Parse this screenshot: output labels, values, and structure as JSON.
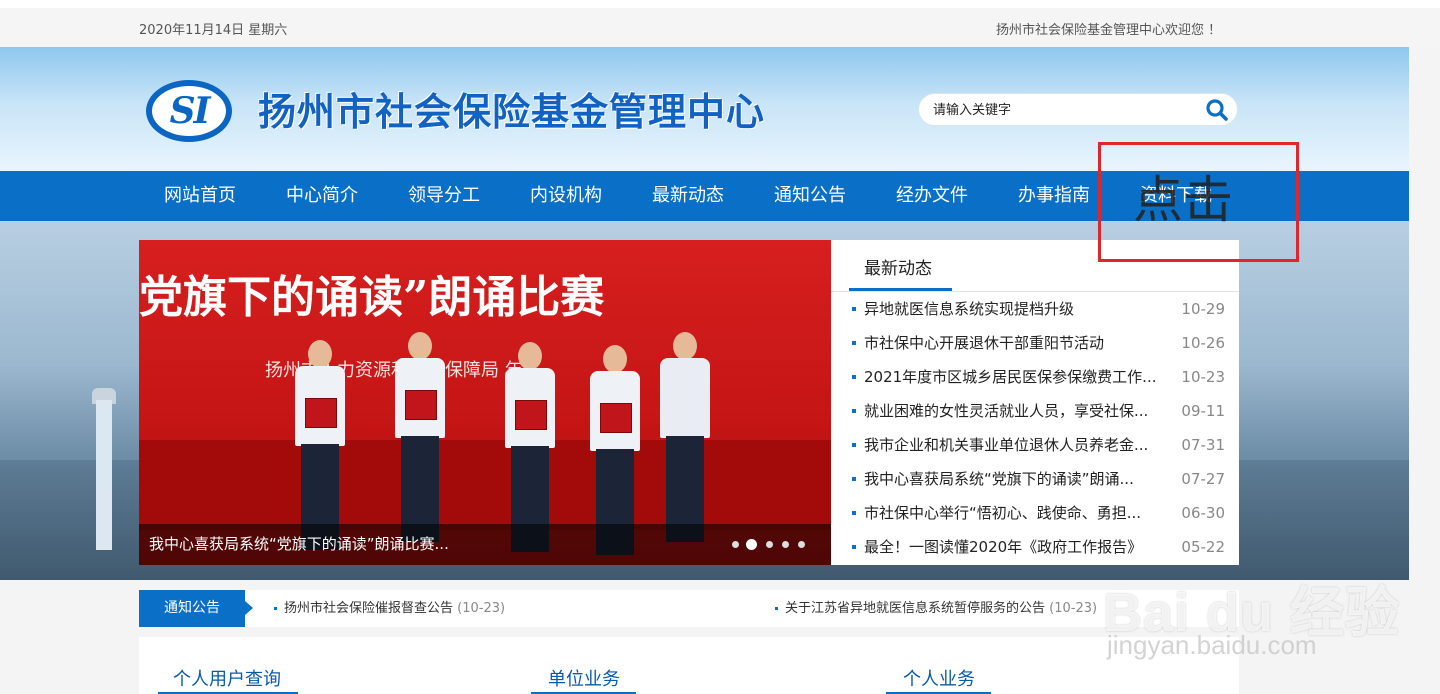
{
  "topbar": {
    "date": "2020年11月14日  星期六",
    "welcome": "扬州市社会保险基金管理中心欢迎您 ！"
  },
  "header": {
    "logo_text": "SI",
    "site_name": "扬州市社会保险基金管理中心",
    "search_placeholder": "请输入关键字"
  },
  "nav": {
    "items": [
      "网站首页",
      "中心简介",
      "领导分工",
      "内设机构",
      "最新动态",
      "通知公告",
      "经办文件",
      "办事指南",
      "资料下载"
    ]
  },
  "slider": {
    "banner_text": "党旗下的诵读”朗诵比赛",
    "sub_text": "扬州市人力资源和社会保障局  年",
    "caption": "我中心喜获局系统“党旗下的诵读”朗诵比赛...",
    "slide_count": 5,
    "active_slide": 1
  },
  "news": {
    "tab": "最新动态",
    "items": [
      {
        "title": "异地就医信息系统实现提档升级",
        "date": "10-29"
      },
      {
        "title": "市社保中心开展退休干部重阳节活动",
        "date": "10-26"
      },
      {
        "title": "2021年度市区城乡居民医保参保缴费工作...",
        "date": "10-23"
      },
      {
        "title": "就业困难的女性灵活就业人员，享受社保...",
        "date": "09-11"
      },
      {
        "title": "我市企业和机关事业单位退休人员养老金...",
        "date": "07-31"
      },
      {
        "title": "我中心喜获局系统“党旗下的诵读”朗诵...",
        "date": "07-27"
      },
      {
        "title": "市社保中心举行“悟初心、践使命、勇担...",
        "date": "06-30"
      },
      {
        "title": "最全！一图读懂2020年《政府工作报告》",
        "date": "05-22"
      }
    ]
  },
  "notice": {
    "label": "通知公告",
    "items": [
      {
        "title": "扬州市社会保险催报督查公告",
        "date": "(10-23)"
      },
      {
        "title": "关于江苏省异地就医信息系统暂停服务的公告",
        "date": "(10-23)"
      }
    ]
  },
  "bottom_tabs": [
    "个人用户查询",
    "单位业务",
    "个人业务"
  ],
  "annotation": {
    "text": "点击",
    "color": "#e0262d"
  },
  "watermark": {
    "main": "Bai du 经验",
    "sub": "jingyan.baidu.com"
  },
  "colors": {
    "brand_blue": "#0a6fc6",
    "slide_red": "#d71f1f"
  }
}
